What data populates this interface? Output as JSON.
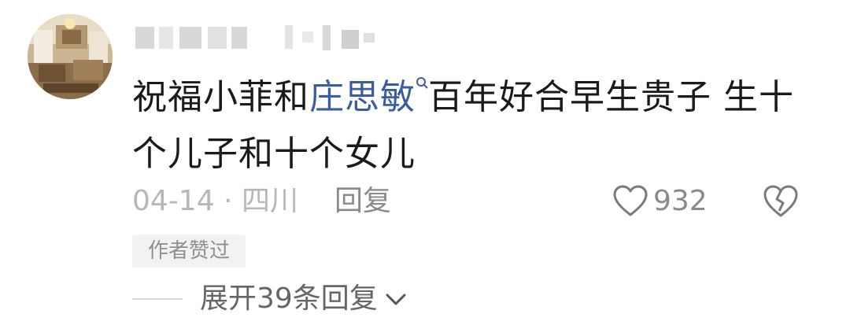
{
  "comment": {
    "prefix": "祝福小菲和",
    "mention": "庄思敏",
    "rest": "百年好合早生贵子 生十个儿子和十个女儿"
  },
  "meta": {
    "date_location": "04-14 · 四川",
    "reply_label": "回复",
    "like_count": "932"
  },
  "badge": {
    "label": "作者赞过"
  },
  "expand": {
    "label": "展开39条回复"
  },
  "icons": {
    "like": "heart-outline-icon",
    "dislike": "broken-heart-icon",
    "search": "search-icon",
    "expand": "chevron-down-icon"
  },
  "colors": {
    "mention": "#3b5c9e",
    "text": "#1a1a1a",
    "meta": "#b7b7b7"
  }
}
